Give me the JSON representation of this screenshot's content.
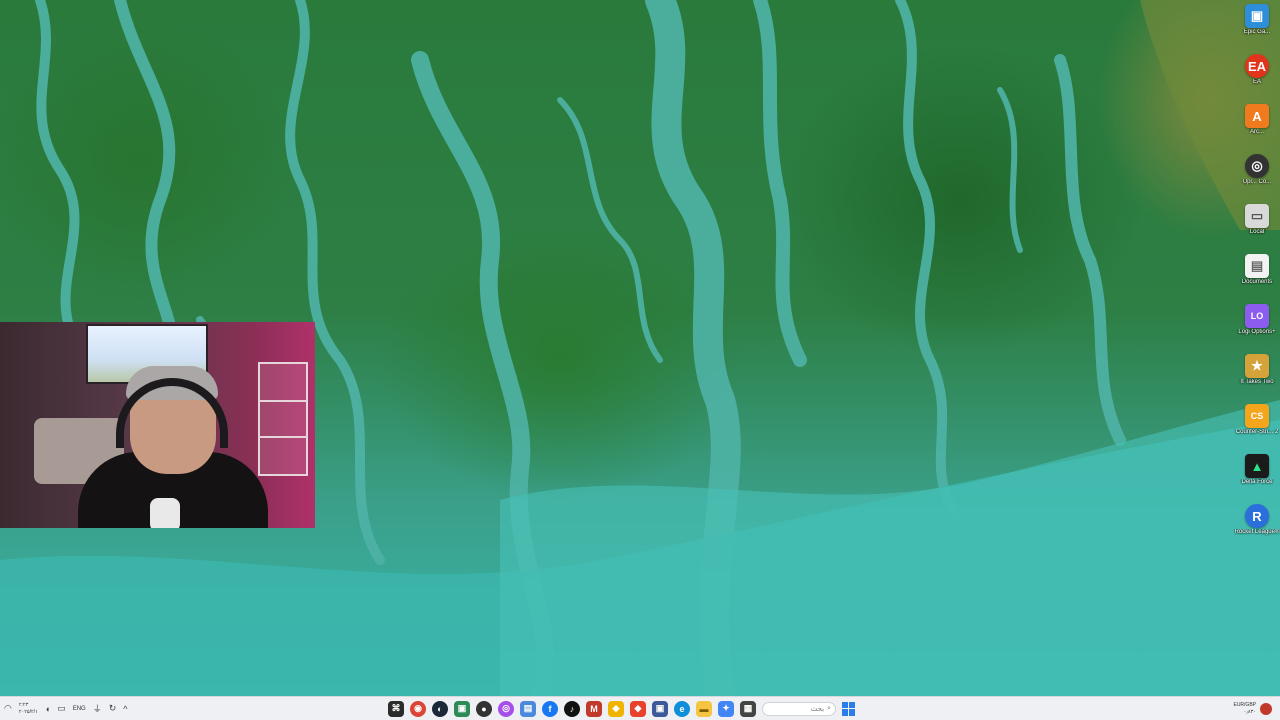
{
  "desktop_icons": [
    {
      "name": "desktop-icon-1",
      "label": "Epic Ga...",
      "color": "#2e8fd8",
      "glyph": "▣"
    },
    {
      "name": "desktop-icon-ea",
      "label": "EA",
      "color": "#e0351b",
      "glyph": "EA"
    },
    {
      "name": "desktop-icon-arc",
      "label": "Arc...",
      "color": "#f07a1e",
      "glyph": "A"
    },
    {
      "name": "desktop-icon-4",
      "label": "Upl... Co...",
      "color": "#333333",
      "glyph": "◎"
    },
    {
      "name": "desktop-icon-5",
      "label": "Local",
      "color": "#d9d9d9",
      "glyph": "▭"
    },
    {
      "name": "desktop-icon-6",
      "label": "Documents",
      "color": "#f2f2f2",
      "glyph": "▤"
    },
    {
      "name": "desktop-icon-logi",
      "label": "Logi Options+",
      "color": "#8c5cf0",
      "glyph": "LO"
    },
    {
      "name": "desktop-icon-8",
      "label": "It Takes Two",
      "color": "#d6a23a",
      "glyph": "★"
    },
    {
      "name": "desktop-icon-counter",
      "label": "Counter-Stri... 2",
      "color": "#f3a51c",
      "glyph": "CS"
    },
    {
      "name": "desktop-icon-delta",
      "label": "Delta Force",
      "color": "#1b1b1b",
      "glyph": "▲"
    },
    {
      "name": "desktop-icon-rocket",
      "label": "Rocket League®",
      "color": "#2a6fdb",
      "glyph": "R"
    }
  ],
  "taskbar": {
    "clock_time": "۲:۲۳",
    "clock_date": "۲۰۲۵/۲/۱",
    "language": "ENG",
    "search_placeholder": "بحث",
    "apps": [
      {
        "name": "taskbar-terminal",
        "glyph": "⌘",
        "color": "#2b2b2b"
      },
      {
        "name": "taskbar-chrome",
        "glyph": "◉",
        "color": "#db4437",
        "round": true
      },
      {
        "name": "taskbar-steam",
        "glyph": "◐",
        "color": "#1b2838",
        "round": true
      },
      {
        "name": "taskbar-app-4",
        "glyph": "▣",
        "color": "#2e8b57"
      },
      {
        "name": "taskbar-app-5",
        "glyph": "●",
        "color": "#333333",
        "round": true
      },
      {
        "name": "taskbar-messenger",
        "glyph": "◎",
        "color": "#a54ee8",
        "round": true
      },
      {
        "name": "taskbar-app-7",
        "glyph": "▤",
        "color": "#4a89dc"
      },
      {
        "name": "taskbar-facebook",
        "glyph": "f",
        "color": "#1877f2",
        "round": true
      },
      {
        "name": "taskbar-tiktok",
        "glyph": "♪",
        "color": "#111111",
        "round": true
      },
      {
        "name": "taskbar-app-10",
        "glyph": "M",
        "color": "#c0392b"
      },
      {
        "name": "taskbar-app-11",
        "glyph": "◆",
        "color": "#f0b400"
      },
      {
        "name": "taskbar-app-12",
        "glyph": "◆",
        "color": "#e8412c"
      },
      {
        "name": "taskbar-app-13",
        "glyph": "▣",
        "color": "#3c5a99"
      },
      {
        "name": "taskbar-edge",
        "glyph": "e",
        "color": "#0f8fd8",
        "round": true
      },
      {
        "name": "taskbar-explorer",
        "glyph": "▬",
        "color": "#f5c542"
      },
      {
        "name": "taskbar-app-16",
        "glyph": "✦",
        "color": "#4285f4"
      },
      {
        "name": "taskbar-app-17",
        "glyph": "▦",
        "color": "#444444"
      }
    ],
    "currency_pair": "EUR/GBP",
    "currency_value": "۰٫۸۳۰"
  }
}
